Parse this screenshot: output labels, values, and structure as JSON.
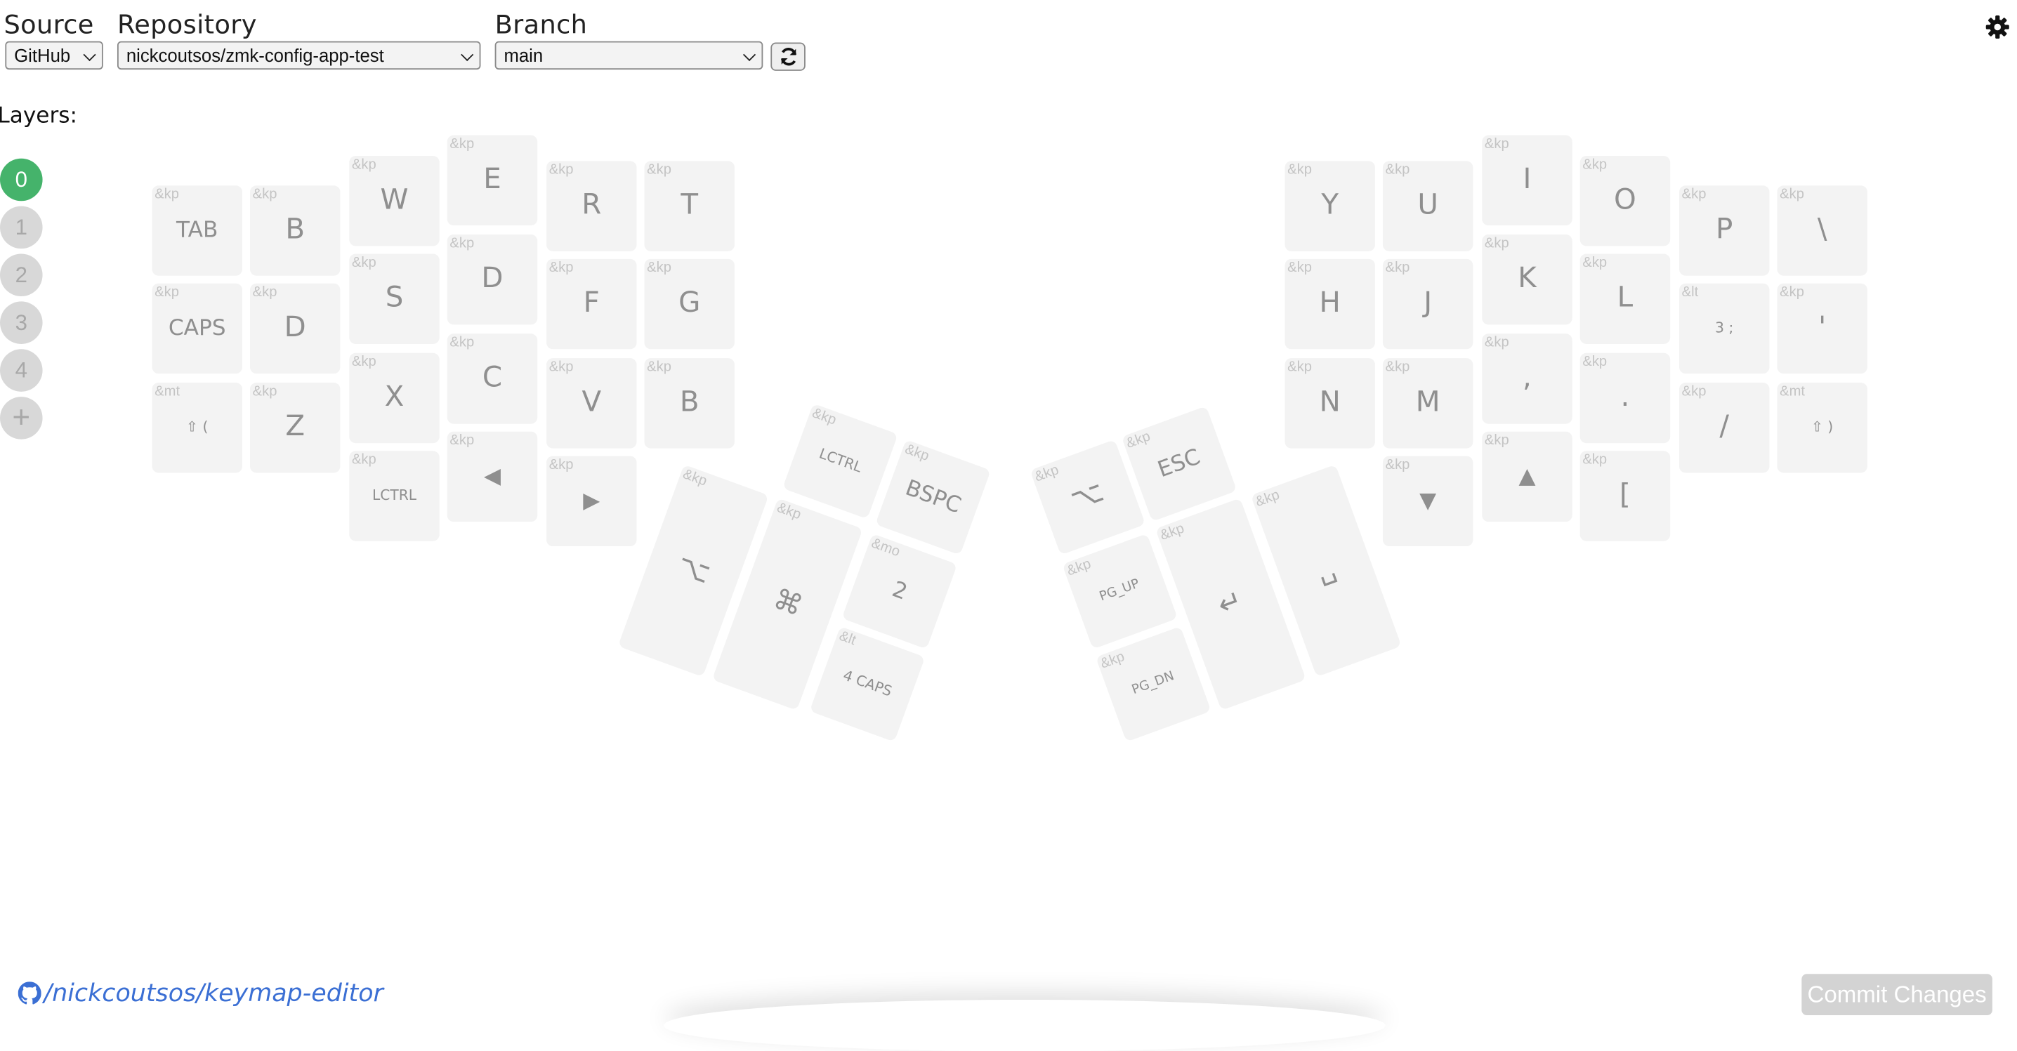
{
  "header": {
    "source": {
      "label": "Source",
      "value": "GitHub"
    },
    "repository": {
      "label": "Repository",
      "value": "nickcoutsos/zmk-config-app-test"
    },
    "branch": {
      "label": "Branch",
      "value": "main"
    },
    "icons": {
      "refresh": "refresh-icon",
      "settings": "gear-icon"
    }
  },
  "layers": {
    "label": "Layers:",
    "items": [
      "0",
      "1",
      "2",
      "3",
      "4"
    ],
    "active": "0",
    "add_label": "+"
  },
  "keys": {
    "l_tab": {
      "binding": "&kp",
      "label": "TAB"
    },
    "l_b1": {
      "binding": "&kp",
      "label": "B"
    },
    "l_w": {
      "binding": "&kp",
      "label": "W"
    },
    "l_e": {
      "binding": "&kp",
      "label": "E"
    },
    "l_r": {
      "binding": "&kp",
      "label": "R"
    },
    "l_t": {
      "binding": "&kp",
      "label": "T"
    },
    "l_caps": {
      "binding": "&kp",
      "label": "CAPS"
    },
    "l_d1": {
      "binding": "&kp",
      "label": "D"
    },
    "l_s": {
      "binding": "&kp",
      "label": "S"
    },
    "l_d2": {
      "binding": "&kp",
      "label": "D"
    },
    "l_f": {
      "binding": "&kp",
      "label": "F"
    },
    "l_g": {
      "binding": "&kp",
      "label": "G"
    },
    "l_mt": {
      "binding": "&mt",
      "label": "⇧ ("
    },
    "l_z": {
      "binding": "&kp",
      "label": "Z"
    },
    "l_x": {
      "binding": "&kp",
      "label": "X"
    },
    "l_c": {
      "binding": "&kp",
      "label": "C"
    },
    "l_v": {
      "binding": "&kp",
      "label": "V"
    },
    "l_b2": {
      "binding": "&kp",
      "label": "B"
    },
    "l_lctrl": {
      "binding": "&kp",
      "label": "LCTRL"
    },
    "l_left": {
      "binding": "&kp",
      "label": "◀",
      "icon": "left-arrow-icon"
    },
    "l_right": {
      "binding": "&kp",
      "label": "▶",
      "icon": "right-arrow-icon"
    },
    "lt_lctrl": {
      "binding": "&kp",
      "label": "LCTRL"
    },
    "lt_bspc": {
      "binding": "&kp",
      "label": "BSPC"
    },
    "lt_opt": {
      "binding": "&kp",
      "label": "⌥",
      "icon": "option-icon"
    },
    "lt_cmd": {
      "binding": "&kp",
      "label": "⌘",
      "icon": "command-icon"
    },
    "lt_mo": {
      "binding": "&mo",
      "label": "2"
    },
    "lt_lt": {
      "binding": "&lt",
      "label": "4 CAPS"
    },
    "rt_opt": {
      "binding": "&kp",
      "label": "⌥",
      "icon": "option-icon"
    },
    "rt_esc": {
      "binding": "&kp",
      "label": "ESC"
    },
    "rt_pgup": {
      "binding": "&kp",
      "label": "PG_UP"
    },
    "rt_enter": {
      "binding": "&kp",
      "label": "↵",
      "icon": "enter-icon"
    },
    "rt_space": {
      "binding": "&kp",
      "label": "␣",
      "icon": "space-icon"
    },
    "rt_pgdn": {
      "binding": "&kp",
      "label": "PG_DN"
    },
    "r_y": {
      "binding": "&kp",
      "label": "Y"
    },
    "r_u": {
      "binding": "&kp",
      "label": "U"
    },
    "r_i": {
      "binding": "&kp",
      "label": "I"
    },
    "r_o": {
      "binding": "&kp",
      "label": "O"
    },
    "r_p": {
      "binding": "&kp",
      "label": "P"
    },
    "r_bslh": {
      "binding": "&kp",
      "label": "\\"
    },
    "r_h": {
      "binding": "&kp",
      "label": "H"
    },
    "r_j": {
      "binding": "&kp",
      "label": "J"
    },
    "r_k": {
      "binding": "&kp",
      "label": "K"
    },
    "r_l": {
      "binding": "&kp",
      "label": "L"
    },
    "r_lt": {
      "binding": "&lt",
      "label": "3 ;"
    },
    "r_apos": {
      "binding": "&kp",
      "label": "'"
    },
    "r_n": {
      "binding": "&kp",
      "label": "N"
    },
    "r_m": {
      "binding": "&kp",
      "label": "M"
    },
    "r_comma": {
      "binding": "&kp",
      "label": ","
    },
    "r_dot": {
      "binding": "&kp",
      "label": "."
    },
    "r_slash": {
      "binding": "&kp",
      "label": "/"
    },
    "r_mt": {
      "binding": "&mt",
      "label": "⇧ )"
    },
    "r_down": {
      "binding": "&kp",
      "label": "▼",
      "icon": "down-arrow-icon"
    },
    "r_up": {
      "binding": "&kp",
      "label": "▲",
      "icon": "up-arrow-icon"
    },
    "r_lbkt": {
      "binding": "&kp",
      "label": "["
    }
  },
  "footer": {
    "link_text": "/nickcoutsos/keymap-editor",
    "link_icon": "github-icon",
    "commit_label": "Commit Changes"
  }
}
